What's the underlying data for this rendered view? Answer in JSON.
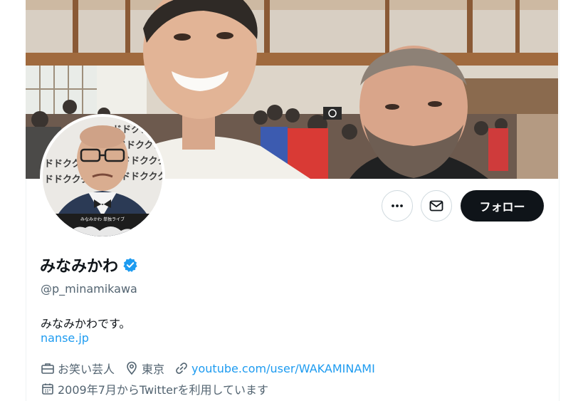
{
  "profile": {
    "display_name": "みなみかわ",
    "handle": "@p_minamikawa",
    "bio": "みなみかわです。",
    "website": "nanse.jp",
    "category": "お笑い芸人",
    "location": "東京",
    "link": "youtube.com/user/WAKAMINAMI",
    "joined": "2009年7月からTwitterを利用しています",
    "verified": true
  },
  "actions": {
    "more_icon": "ellipsis-icon",
    "message_icon": "envelope-icon",
    "follow_label": "フォロー"
  },
  "avatar": {
    "poster_text": "みなみかわ 単独ライブ",
    "pattern_glyphs": "ドドクククンン"
  },
  "colors": {
    "link": "#1d9bf0",
    "verified": "#1d9bf0",
    "follow_bg": "#0f1419"
  }
}
